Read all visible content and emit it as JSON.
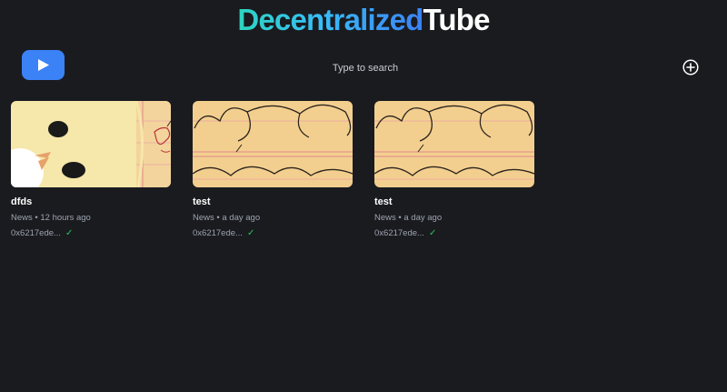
{
  "header": {
    "brand_part1": "Decentralized",
    "brand_part2": "Tube",
    "logo_icon": "play-icon",
    "upload_icon": "plus-circle-icon"
  },
  "search": {
    "placeholder": "Type to search",
    "value": ""
  },
  "colors": {
    "background": "#1a1b1f",
    "accent": "#3b82f6",
    "brand_gradient_start": "#2dd4bf",
    "brand_gradient_end": "#3b82f6",
    "verified": "#22c55e"
  },
  "videos": [
    {
      "title": "dfds",
      "category": "News",
      "time": "12 hours ago",
      "owner": "0x6217ede...",
      "verified_icon": "check-icon"
    },
    {
      "title": "test",
      "category": "News",
      "time": "a day ago",
      "owner": "0x6217ede...",
      "verified_icon": "check-icon"
    },
    {
      "title": "test",
      "category": "News",
      "time": "a day ago",
      "owner": "0x6217ede...",
      "verified_icon": "check-icon"
    }
  ]
}
